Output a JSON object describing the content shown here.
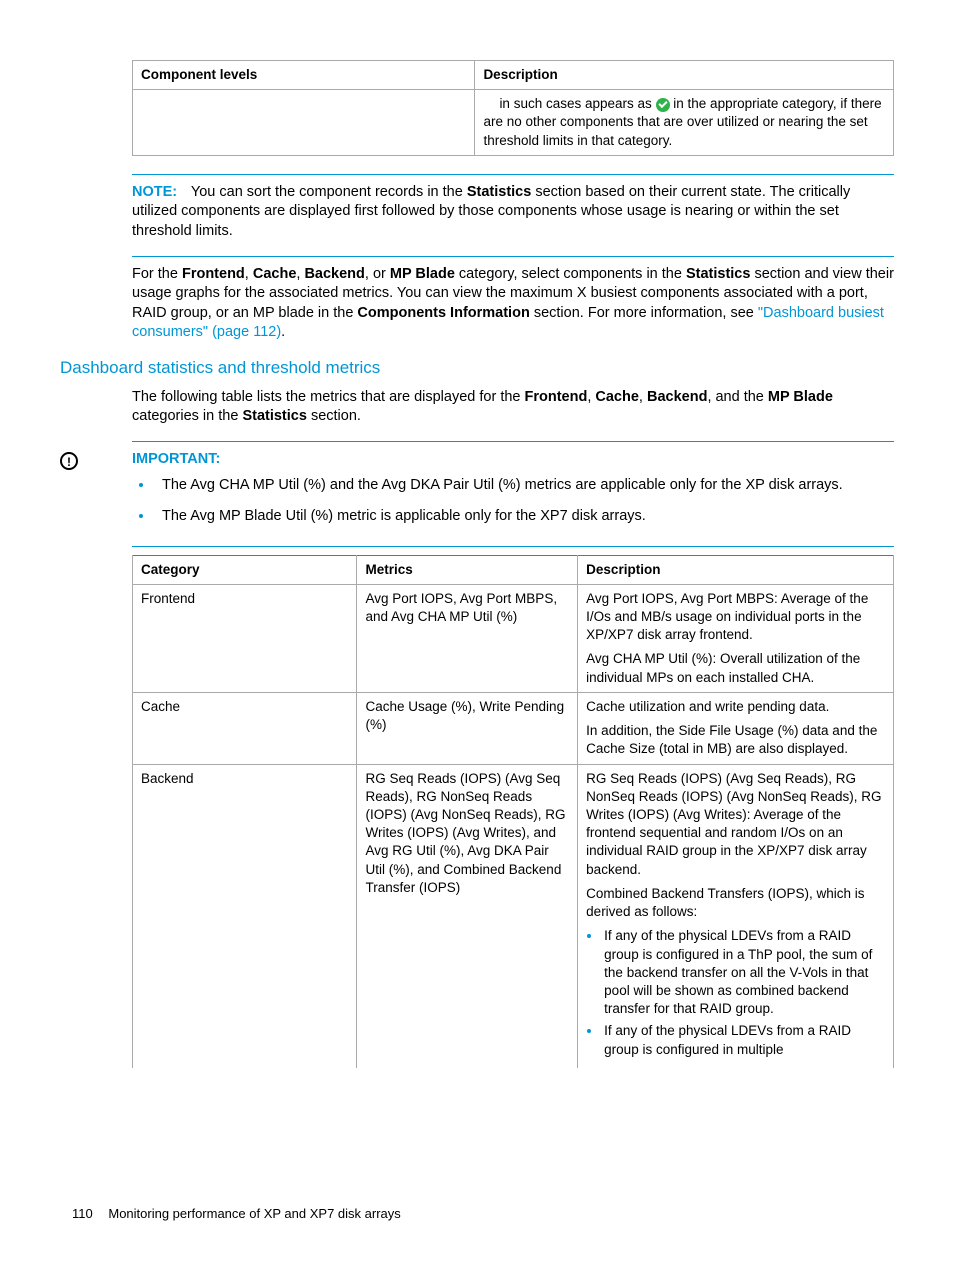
{
  "table1": {
    "headers": {
      "col1": "Component levels",
      "col2": "Description"
    },
    "row": {
      "c1": "",
      "c2_pre": "in such cases appears as ",
      "c2_post": " in the appropriate category, if there are no other components that are over utilized or nearing the set threshold limits in that category."
    }
  },
  "note": {
    "label": "NOTE:",
    "t1": "You can sort the component records in the ",
    "b1": "Statistics",
    "t2": " section based on their current state. The critically utilized components are displayed first followed by those components whose usage is nearing or within the set threshold limits."
  },
  "para2": {
    "t1": "For the ",
    "b1": "Frontend",
    "c1": ", ",
    "b2": "Cache",
    "c2": ", ",
    "b3": "Backend",
    "c3": ", or ",
    "b4": "MP Blade",
    "t2": " category, select components in the ",
    "b5": "Statistics",
    "t3": " section and view their usage graphs for the associated metrics. You can view the maximum X busiest components associated with a port, RAID group, or an MP blade in the ",
    "b6": "Components Information",
    "t4": " section. For more information, see ",
    "link": "\"Dashboard busiest consumers\" (page 112)",
    "t5": "."
  },
  "heading": "Dashboard statistics and threshold metrics",
  "para3": {
    "t1": "The following table lists the metrics that are displayed for the ",
    "b1": "Frontend",
    "c1": ", ",
    "b2": "Cache",
    "c2": ", ",
    "b3": "Backend",
    "c3": ", and the ",
    "b4": "MP Blade",
    "t2": " categories in the ",
    "b5": "Statistics",
    "t3": " section."
  },
  "important": {
    "label": "IMPORTANT:",
    "li1": "The Avg CHA MP Util (%) and the Avg DKA Pair Util (%) metrics are applicable only for the XP disk arrays.",
    "li2": "The Avg MP Blade Util (%) metric is applicable only for the XP7 disk arrays."
  },
  "table2": {
    "headers": {
      "c1": "Category",
      "c2": "Metrics",
      "c3": "Description"
    },
    "rows": {
      "r0": {
        "cat": "Frontend",
        "met": "Avg Port IOPS, Avg Port MBPS, and Avg CHA MP Util (%)",
        "d1": "Avg Port IOPS, Avg Port MBPS: Average of the I/Os and MB/s usage on individual ports in the XP/XP7 disk array frontend.",
        "d2": "Avg CHA MP Util (%): Overall utilization of the individual MPs on each installed CHA."
      },
      "r1": {
        "cat": "Cache",
        "met": "Cache Usage (%), Write Pending (%)",
        "d1": "Cache utilization and write pending data.",
        "d2": "In addition, the Side File Usage (%) data and the Cache Size (total in MB) are also displayed."
      },
      "r2": {
        "cat": "Backend",
        "met": "RG Seq Reads (IOPS) (Avg Seq Reads), RG NonSeq Reads (IOPS) (Avg NonSeq Reads), RG Writes (IOPS) (Avg Writes), and Avg RG Util (%), Avg DKA Pair Util (%), and Combined Backend Transfer (IOPS)",
        "d1": "RG Seq Reads (IOPS) (Avg Seq Reads), RG NonSeq Reads (IOPS) (Avg NonSeq Reads), RG Writes (IOPS) (Avg Writes): Average of the frontend sequential and random I/Os on an individual RAID group in the XP/XP7 disk array backend.",
        "d2": "Combined Backend Transfers (IOPS), which is derived as follows:",
        "li1": "If any of the physical LDEVs from a RAID group is configured in a ThP pool, the sum of the backend transfer on all the V-Vols in that pool will be shown as combined backend transfer for that RAID group.",
        "li2": "If any of the physical LDEVs from a RAID group is configured in multiple"
      }
    }
  },
  "footer": {
    "pagenum": "110",
    "title": "Monitoring performance of XP and XP7 disk arrays"
  }
}
